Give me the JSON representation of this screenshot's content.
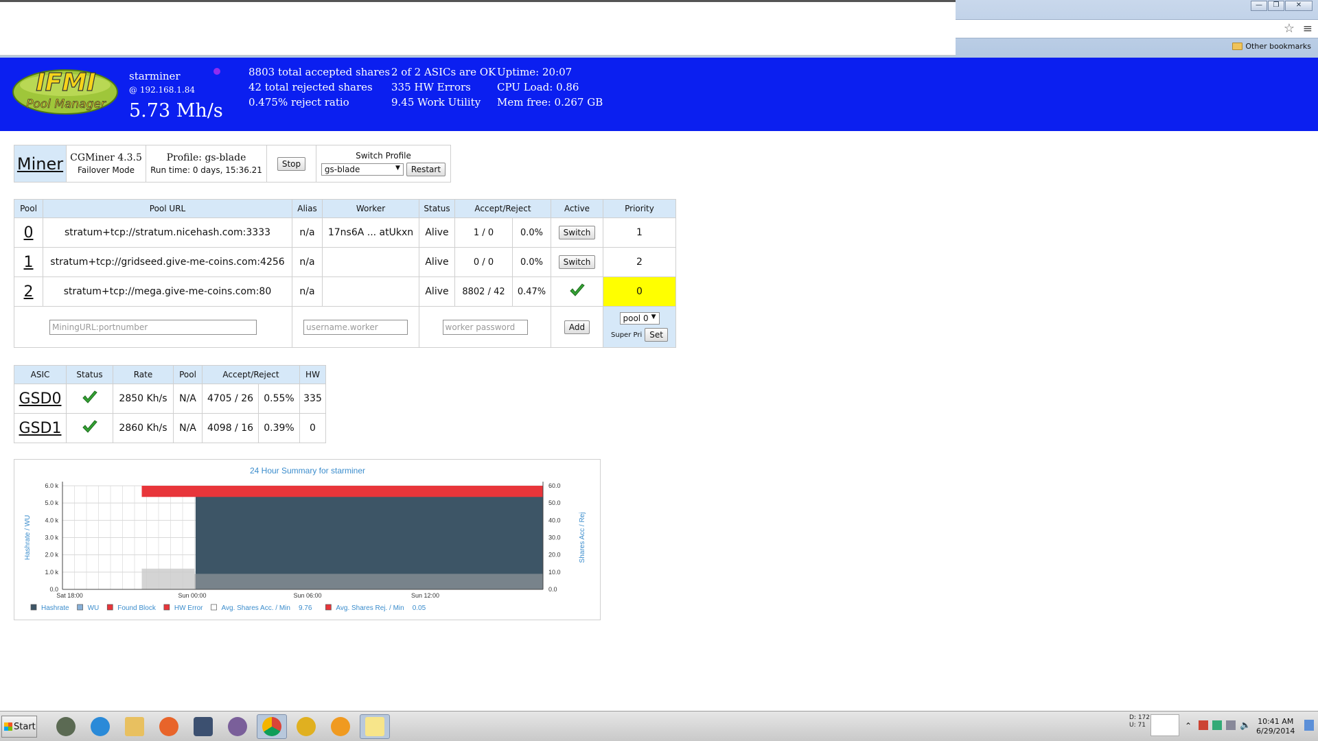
{
  "browser": {
    "bookmark_folder": "Other bookmarks",
    "min_label": "—",
    "max_label": "❐",
    "close_label": "✕"
  },
  "header": {
    "logo_line1": "IFMI",
    "logo_line2": "Pool Manager",
    "miner_name": "starminer",
    "miner_ip": "@ 192.168.1.84",
    "hashrate": "5.73 Mh/s",
    "stats_col1": [
      "8803 total accepted shares",
      "42 total rejected shares",
      "0.475% reject ratio"
    ],
    "stats_col2": [
      "2 of 2 ASICs are OK",
      "335 HW Errors",
      "9.45 Work Utility"
    ],
    "stats_col3": [
      "Uptime: 20:07",
      "CPU Load: 0.86",
      "Mem free: 0.267 GB"
    ]
  },
  "miner": {
    "title": "Miner",
    "version": "CGMiner 4.3.5",
    "mode": "Failover Mode",
    "profile": "Profile: gs-blade",
    "runtime": "Run time: 0 days, 15:36.21",
    "stop_label": "Stop",
    "switch_profile_label": "Switch Profile",
    "profile_selected": "gs-blade",
    "restart_label": "Restart"
  },
  "pools": {
    "headers": [
      "Pool",
      "Pool URL",
      "Alias",
      "Worker",
      "Status",
      "Accept/Reject",
      "Active",
      "Priority"
    ],
    "rows": [
      {
        "id": "0",
        "url": "stratum+tcp://stratum.nicehash.com:3333",
        "alias": "n/a",
        "worker": "17ns6A ... atUkxn",
        "status": "Alive",
        "accept_reject": "1 / 0",
        "ratio": "0.0%",
        "active": "Switch",
        "priority": "1"
      },
      {
        "id": "1",
        "url": "stratum+tcp://gridseed.give-me-coins.com:4256",
        "alias": "n/a",
        "worker": "",
        "status": "Alive",
        "accept_reject": "0 / 0",
        "ratio": "0.0%",
        "active": "Switch",
        "priority": "2"
      },
      {
        "id": "2",
        "url": "stratum+tcp://mega.give-me-coins.com:80",
        "alias": "n/a",
        "worker": "",
        "status": "Alive",
        "accept_reject": "8802 / 42",
        "ratio": "0.47%",
        "active": "",
        "priority": "0"
      }
    ],
    "new_url_placeholder": "MiningURL:portnumber",
    "new_worker_placeholder": "username.worker",
    "new_password_placeholder": "worker password",
    "add_label": "Add",
    "pool_select": "pool 0",
    "super_pri_label": "Super Pri",
    "set_label": "Set",
    "highlight_color": "#ffff00"
  },
  "asics": {
    "headers": [
      "ASIC",
      "Status",
      "Rate",
      "Pool",
      "Accept/Reject",
      "HW"
    ],
    "rows": [
      {
        "id": "GSD0",
        "rate": "2850 Kh/s",
        "pool": "N/A",
        "accept_reject": "4705 / 26",
        "ratio": "0.55%",
        "hw": "335"
      },
      {
        "id": "GSD1",
        "rate": "2860 Kh/s",
        "pool": "N/A",
        "accept_reject": "4098 / 16",
        "ratio": "0.39%",
        "hw": "0"
      }
    ]
  },
  "chart_data": {
    "type": "area",
    "title": "24 Hour Summary for starminer",
    "ylabel": "Hashrate / WU",
    "y2label": "Shares Acc / Rej",
    "y_ticks": [
      "0.0",
      "1.0 k",
      "2.0 k",
      "3.0 k",
      "4.0 k",
      "5.0 k",
      "6.0 k"
    ],
    "y2_ticks": [
      "0.0",
      "10.0",
      "20.0",
      "30.0",
      "40.0",
      "50.0",
      "60.0"
    ],
    "x_ticks": [
      "Sat 18:00",
      "Sun 00:00",
      "Sun 06:00",
      "Sun 12:00"
    ],
    "ylim": [
      0,
      6000
    ],
    "y2lim": [
      0,
      60
    ],
    "legend": [
      {
        "name": "Hashrate",
        "color": "#3d5566"
      },
      {
        "name": "WU",
        "color": "#88b0d8"
      },
      {
        "name": "Found Block",
        "color": "#e8353a"
      },
      {
        "name": "HW Error",
        "color": "#e8353a"
      },
      {
        "name": "Avg. Shares Acc. / Min",
        "value": "9.76",
        "color": "#ffffff"
      },
      {
        "name": "Avg. Shares Rej. / Min",
        "value": "0.05",
        "color": "#e8353a"
      }
    ],
    "series": [
      {
        "name": "Hashrate",
        "color": "#3d5566",
        "segments": [
          {
            "x0": 0.277,
            "x1": 1.0,
            "value": 5400
          }
        ]
      },
      {
        "name": "WU",
        "color": "#c9c9c9",
        "segments": [
          {
            "x0": 0.165,
            "x1": 0.275,
            "value": 1200
          },
          {
            "x0": 0.275,
            "x1": 1.0,
            "value": 900
          }
        ]
      },
      {
        "name": "HW Error",
        "color": "#e8353a",
        "segments": [
          {
            "x0": 0.165,
            "x1": 1.0,
            "value": 5750
          }
        ]
      }
    ]
  },
  "taskbar": {
    "start_label": "Start",
    "tray_stats": [
      "D: 172",
      "U: 71"
    ],
    "clock_time": "10:41 AM",
    "clock_date": "6/29/2014"
  }
}
